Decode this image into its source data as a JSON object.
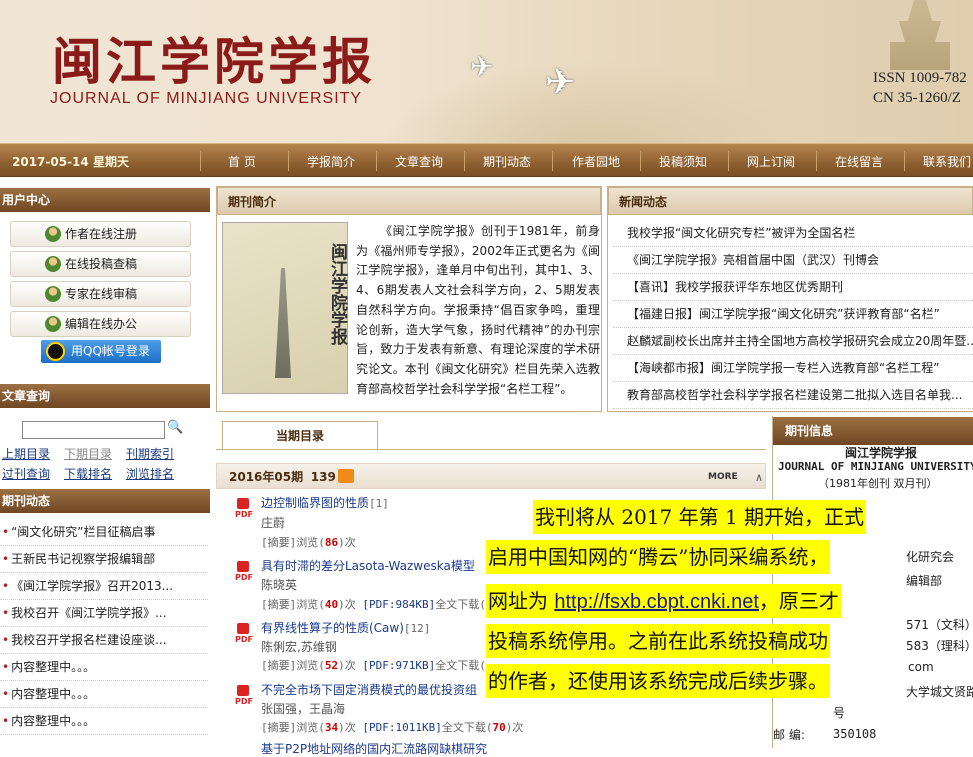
{
  "header": {
    "title_cn": "闽江学院学报",
    "title_en": "JOURNAL OF MINJIANG UNIVERSITY",
    "issn": "ISSN 1009-782",
    "cn": "CN 35-1260/Z"
  },
  "nav": {
    "date": "2017-05-14",
    "weekday": "星期天",
    "items": [
      "首 页",
      "学报简介",
      "文章查询",
      "期刊动态",
      "作者园地",
      "投稿须知",
      "网上订阅",
      "在线留言",
      "联系我们"
    ]
  },
  "sidebar": {
    "user_center": "用户中心",
    "user_buttons": [
      "作者在线注册",
      "在线投稿查稿",
      "专家在线审稿",
      "编辑在线办公"
    ],
    "qq_login": "用QQ帐号登录",
    "article_search": "文章查询",
    "search_links": [
      "上期目录",
      "下期目录",
      "刊期索引",
      "过刊查询",
      "下载排名",
      "浏览排名"
    ],
    "journal_news": "期刊动态",
    "news_items": [
      "“闽文化研究”栏目征稿启事",
      "王新民书记视察学报编辑部",
      "《闽江学院学报》召开2013...",
      "我校召开《闽江学院学报》...",
      "我校召开学报名栏建设座谈...",
      "内容整理中。。。",
      "内容整理中。。。",
      "内容整理中。。。"
    ]
  },
  "intro": {
    "head": "期刊简介",
    "cover_title": "闽江学院学报",
    "text": "《闽江学院学报》创刊于1981年，前身为《福州师专学报》，2002年正式更名为《闽江学院学报》，逢单月中旬出刊，其中1、3、4、6期发表人文社会科学方向，2、5期发表自然科学方向。学报秉持“倡百家争鸣，重理论创新，造大学气象，扬时代精神”的办刊宗旨，致力于发表有新意、有理论深度的学术研究论文。本刊《闽文化研究》栏目先荣入选教育部高校哲学社会科学学报“名栏工程”。"
  },
  "news": {
    "head": "新闻动态",
    "items": [
      "我校学报“闽文化研究专栏”被评为全国名栏",
      "《闽江学院学报》亮相首届中国（武汉）刊博会",
      "【喜讯】我校学报获评华东地区优秀期刊",
      "【福建日报】闽江学院学报“闽文化研究”获评教育部“名栏”",
      "赵麟斌副校长出席并主持全国地方高校学报研究会成立20周年暨...",
      "【海峡都市报】闽江学院学报一专栏入选教育部“名栏工程”",
      "教育部高校哲学社会科学学报名栏建设第二批拟入选目名单我..."
    ]
  },
  "toc": {
    "tab": "当期目录",
    "issue": "2016年05期",
    "count": "139",
    "more": "MORE",
    "pdf_label": "PDF",
    "articles": [
      {
        "title": "边控制临界图的性质",
        "page": "[1]",
        "authors": "庄蔚",
        "views": "86",
        "pdf": "",
        "downloads": ""
      },
      {
        "title": "具有时滞的差分Lasota-Wazweska模型",
        "page": "",
        "authors": "陈晓英",
        "views": "40",
        "pdf": "PDF:984KB",
        "downloads": ""
      },
      {
        "title": "有界线性算子的性质(Caw)",
        "page": "[12]",
        "authors": "陈俐宏,苏维钢",
        "views": "52",
        "pdf": "PDF:971KB",
        "downloads": ""
      },
      {
        "title": "不完全市场下固定消费模式的最优投资组",
        "page": "",
        "authors": "张国强，王晶海",
        "views": "34",
        "pdf": "PDF:1011KB",
        "downloads": "70"
      }
    ],
    "abstract_label": "[摘要]浏览(",
    "times": ")次",
    "fulltext": "全文下载(",
    "last_partial": "基于P2P地址网络的国内汇流路网缺棋研究"
  },
  "journal_info": {
    "head": "期刊信息",
    "name_cn": "闽江学院学报",
    "name_en": "JOURNAL OF MINJIANG UNIVERSITY",
    "founded": "（1981年创刊 双月刊）",
    "l1": "化研究会",
    "l2": "编辑部",
    "l3": "571（文科）",
    "l4": "583（理科）",
    "l5": "com",
    "l6": "大学城文贤路",
    "l7": "号",
    "postcode_label": "邮 编:",
    "postcode": "350108"
  },
  "notice": {
    "line1": "我刊将从 2017 年第 1 期开始，正式",
    "line2": "启用中国知网的“腾云”协同采编系统，",
    "line3a": "网址为 ",
    "url": "http://fsxb.cbpt.cnki.net",
    "line3b": "，原三才",
    "line4": "投稿系统停用。之前在此系统投稿成功",
    "line5": "的作者，还使用该系统完成后续步骤。"
  }
}
